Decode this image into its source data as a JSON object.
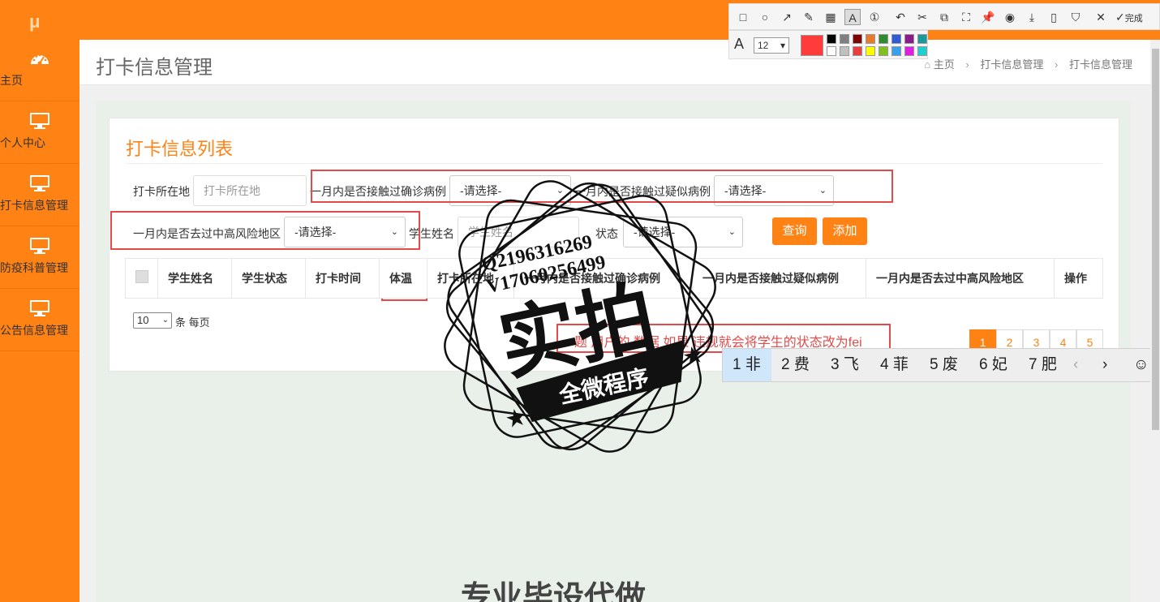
{
  "sidebar": {
    "logo": "μ",
    "items": [
      {
        "label": "主页",
        "icon": "dashboard-icon"
      },
      {
        "label": "个人中心",
        "icon": "monitor-icon"
      },
      {
        "label": "打卡信息管理",
        "icon": "monitor-icon"
      },
      {
        "label": "防疫科普管理",
        "icon": "monitor-icon"
      },
      {
        "label": "公告信息管理",
        "icon": "monitor-icon"
      }
    ]
  },
  "header": {
    "title": "打卡信息管理",
    "breadcrumb": [
      "主页",
      "打卡信息管理",
      "打卡信息管理"
    ]
  },
  "panel": {
    "title": "打卡信息列表",
    "filters": {
      "location_label": "打卡所在地",
      "location_placeholder": "打卡所在地",
      "confirmed_label": "一月内是否接触过确诊病例",
      "confirmed_value": "-请选择-",
      "suspected_label": "一月内是否接触过疑似病例",
      "suspected_value": "-请选择-",
      "risk_label": "一月内是否去过中高风险地区",
      "risk_value": "-请选择-",
      "name_label": "学生姓名",
      "name_placeholder": "学生姓名",
      "status_label": "状态",
      "status_value": "-请选择-"
    },
    "buttons": {
      "query": "查询",
      "add": "添加"
    },
    "table_headers": [
      "学生姓名",
      "学生状态",
      "打卡时间",
      "体温",
      "打卡所在地",
      "一月内是否接触过确诊病例",
      "一月内是否接触过疑似病例",
      "一月内是否去过中高风险地区",
      "操作"
    ],
    "page_size": "10",
    "page_size_suffix": "条 每页",
    "pages": [
      "1",
      "2",
      "3",
      "4",
      "5"
    ],
    "annotation": "题 用户的 数据 如果 违规就会将学生的状态改为fei"
  },
  "screenshot_tool": {
    "font_size": "12",
    "done_label": "完成",
    "colors": [
      "#000000",
      "#808080",
      "#800000",
      "#e87b2b",
      "#2e8b2e",
      "#2f5bd6",
      "#8b1a8b",
      "#1a9a9a",
      "#ffffff",
      "#c0c0c0",
      "#e84040",
      "#ffff00",
      "#80c020",
      "#3aa0e8",
      "#e020e0",
      "#20d0d0"
    ],
    "selected_color": "#ff3b3b"
  },
  "ime": {
    "candidates": [
      "1 非",
      "2 费",
      "3 飞",
      "4 菲",
      "5 废",
      "6 妃",
      "7 肥"
    ]
  },
  "watermark": {
    "line1": "Q2196316269",
    "line2": "V17060256499",
    "main": "实拍",
    "banner": "全微程序"
  },
  "bottom_text": "专业毕设代做"
}
